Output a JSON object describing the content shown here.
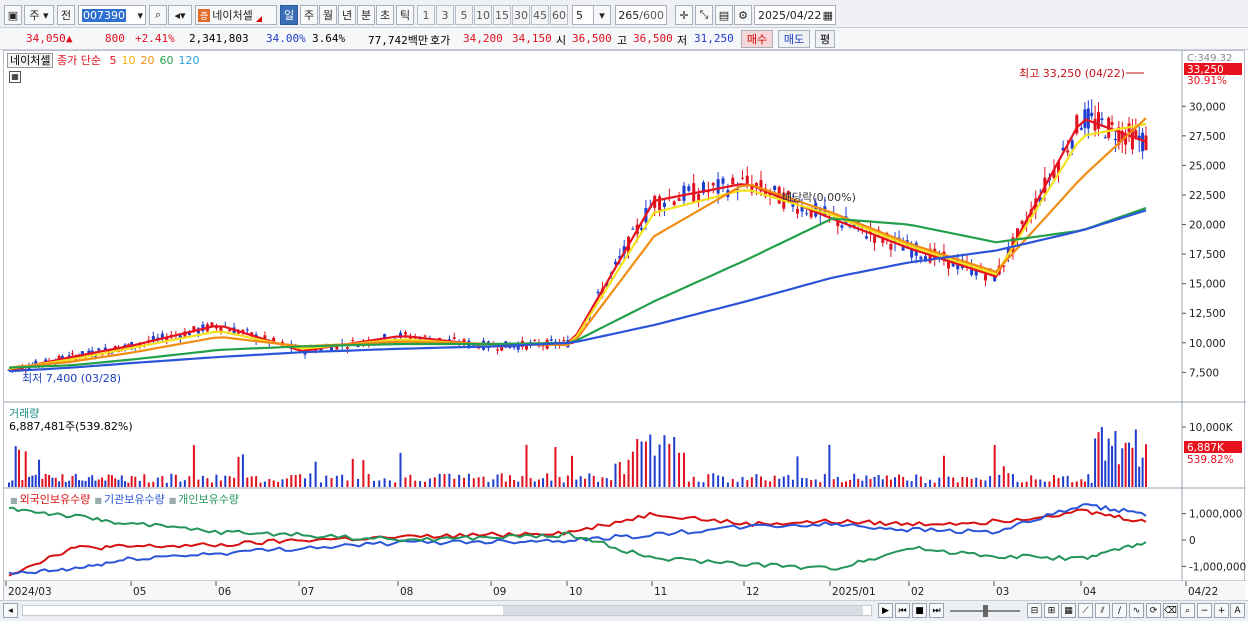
{
  "toolbar": {
    "market_label": "주",
    "compare_label": "전",
    "stock_code": "007390",
    "stock_tag": "증",
    "stock_name": "네이처셀",
    "period_tabs": [
      "일",
      "주",
      "월",
      "년",
      "분",
      "초",
      "틱"
    ],
    "active_period": "일",
    "interval_buttons": [
      "1",
      "3",
      "5",
      "10",
      "15",
      "30",
      "45",
      "60"
    ],
    "interval_value": "5",
    "count_value": "265",
    "count_total": "/600",
    "date_value": "2025/04/22"
  },
  "quote": {
    "price": "34,050",
    "change": "800",
    "change_pct": "+2.41%",
    "volume": "2,341,803",
    "turnover_pct": "34.00%",
    "turnover2_pct": "3.64%",
    "amount": "77,742백만",
    "bid_label": "호가",
    "bid": "34,200",
    "ask": "34,150",
    "open_label": "시",
    "open": "36,500",
    "high_label": "고",
    "high": "36,500",
    "low_label": "저",
    "low": "31,250",
    "buy_label": "매수",
    "sell_label": "매도",
    "avg_label": "평"
  },
  "price_pane": {
    "name_badge": "네이처셀",
    "legend_prefix": "종가 단순",
    "ma_periods": [
      "5",
      "10",
      "20",
      "60",
      "120"
    ],
    "ma_colors": [
      "#e8121f",
      "#f4b414",
      "#22a04a",
      "#2a55d8",
      "#2a55d8"
    ],
    "max_annotation": "최고 33,250 (04/22)",
    "min_annotation": "최저 7,400 (03/28)",
    "dividend_annotation": "배당락(0.00%)",
    "current_price_tag": "33,250",
    "current_pct_tag": "30.91%",
    "top_tag": "C:349.32"
  },
  "volume_pane": {
    "title": "거래량",
    "value_text": "6,887,481주(539.82%)",
    "current_tag": "6,887K",
    "current_pct": "539.82%"
  },
  "holding_pane": {
    "series_names": [
      "외국인보유수량",
      "기관보유수량",
      "개인보유수량"
    ],
    "series_colors": [
      "#d71010",
      "#2a55d8",
      "#23945a"
    ]
  },
  "x_axis_labels": [
    "2024/03",
    "05",
    "06",
    "07",
    "08",
    "09",
    "10",
    "11",
    "12",
    "2025/01",
    "02",
    "03",
    "04",
    "04/22"
  ],
  "colors": {
    "up": "#e0101e",
    "down": "#1e3ccd",
    "active_tab": "#3a6fb8"
  },
  "chart_data": [
    {
      "type": "line",
      "title": "",
      "ylim": [
        5500,
        34000
      ],
      "ylabels": [
        "30,000",
        "27,500",
        "25,000",
        "22,500",
        "20,000",
        "17,500",
        "15,000",
        "12,500",
        "10,000",
        "7,500"
      ],
      "y_ticks": [
        30000,
        27500,
        25000,
        22500,
        20000,
        17500,
        15000,
        12500,
        10000,
        7500
      ],
      "x": [
        "2024/03",
        "04",
        "05",
        "06",
        "07",
        "08",
        "09",
        "10",
        "11",
        "12",
        "2025/01",
        "02",
        "03",
        "04",
        "04/22"
      ],
      "series": [
        {
          "name": "5",
          "values": [
            7700,
            8800,
            9800,
            11500,
            9300,
            10600,
            9700,
            10000,
            22000,
            23500,
            20500,
            18000,
            15600,
            29000,
            27000
          ]
        },
        {
          "name": "10",
          "values": [
            7800,
            8600,
            9600,
            11000,
            9500,
            10300,
            9800,
            9900,
            21000,
            23000,
            20800,
            18200,
            15800,
            27500,
            28500
          ]
        },
        {
          "name": "20",
          "values": [
            7900,
            8400,
            9200,
            10500,
            9700,
            10100,
            9900,
            9800,
            19000,
            23500,
            21000,
            18400,
            16000,
            24000,
            29000
          ]
        },
        {
          "name": "60",
          "values": [
            7900,
            8100,
            8600,
            9400,
            9700,
            9900,
            9900,
            10000,
            13500,
            17000,
            20500,
            20000,
            18500,
            19500,
            21400
          ]
        },
        {
          "name": "120",
          "values": [
            7600,
            7900,
            8300,
            8800,
            9200,
            9500,
            9700,
            10000,
            11500,
            13500,
            15500,
            16800,
            17800,
            19500,
            21200
          ]
        }
      ]
    },
    {
      "type": "bar",
      "title": "",
      "ylabels": [
        "10,000K"
      ],
      "y_ticks": [
        10000
      ]
    },
    {
      "type": "line",
      "title": "",
      "ylabels": [
        "1,000,000",
        "0",
        "-1,000,000"
      ],
      "y_ticks": [
        1000000,
        0,
        -1000000
      ]
    }
  ]
}
